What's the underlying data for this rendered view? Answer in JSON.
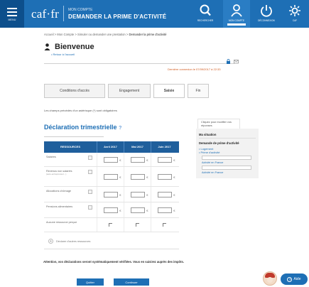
{
  "header": {
    "menu_label": "MENU",
    "logo": "caf·fr",
    "account_label": "MON COMPTE",
    "page_title": "DEMANDER LA PRIME D'ACTIVITÉ",
    "icons": [
      {
        "name": "search-icon",
        "label": "RECHERCHER"
      },
      {
        "name": "account-icon",
        "label": "MON COMPTE"
      },
      {
        "name": "logout-icon",
        "label": "DÉCONNEXION"
      },
      {
        "name": "settings-icon",
        "label": "CAF"
      }
    ]
  },
  "breadcrumb": {
    "path": "Accueil > Mon Compte > Simuler ou demander une prestation > ",
    "current": "Demander la prime d'activité"
  },
  "welcome": {
    "title": "Bienvenue",
    "back_link": "• Retour à l'accueil",
    "last_connection": "Dernière connexion le 07/09/2017 à 22:33"
  },
  "steps": [
    "Conditions d'accès",
    "Engagement",
    "Saisie",
    "Fin"
  ],
  "mandatory_note": "Les champs précédés d'un astérisque (*) sont obligatoires",
  "form": {
    "title": "Déclaration trimestrielle",
    "title_help": "?",
    "headers": [
      "RESSOURCES",
      "Avril 2017",
      "Mai 2017",
      "Juin 2017"
    ],
    "rows": [
      {
        "label": "Salaires",
        "sub": "",
        "type": "input"
      },
      {
        "label": "Revenus non salariés",
        "sub": "(auto-entrepreneur...)",
        "type": "input"
      },
      {
        "label": "Allocations chômage",
        "sub": "",
        "type": "input"
      },
      {
        "label": "Pensions alimentaires",
        "sub": "",
        "type": "input"
      },
      {
        "label": "Aucune ressource perçue",
        "sub": "",
        "type": "checkbox"
      }
    ],
    "add_resources": "Déclarer d'autres ressources",
    "attention": "Attention, vos déclarations seront systématiquement vérifiées. Vous en saisirez auprès des impôts.",
    "buttons": {
      "quit": "Quitter",
      "continue": "Continuer"
    }
  },
  "sidebar": {
    "note": "Cliquez pour modifier vos réponses",
    "section_title": "Ma situation",
    "demand_title": "Demande de prime d'activité",
    "items": [
      "Logement",
      "Prime d'activité"
    ],
    "activity_link_1": "Activité en France",
    "activity_link_2": "Activité en France"
  },
  "help": {
    "label": "Aide",
    "icon": "?"
  },
  "colors": {
    "brand": "#1e6fb5",
    "header_dark": "#0d4f8c",
    "table_head": "#1f5f9c",
    "alert": "#d15a1e"
  }
}
